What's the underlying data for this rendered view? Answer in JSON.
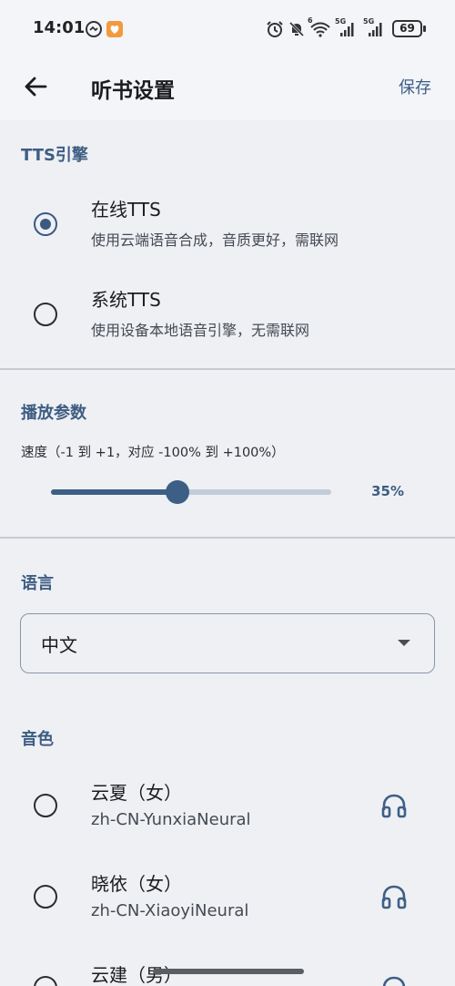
{
  "status_bar": {
    "time": "14:01",
    "battery": "69",
    "network_1": "5G",
    "network_2": "5G",
    "wifi_label": "6"
  },
  "app_bar": {
    "title": "听书设置",
    "save_label": "保存"
  },
  "tts_engine": {
    "section_title": "TTS引擎",
    "options": [
      {
        "title": "在线TTS",
        "subtitle": "使用云端语音合成，音质更好，需联网",
        "selected": true
      },
      {
        "title": "系统TTS",
        "subtitle": "使用设备本地语音引擎，无需联网",
        "selected": false
      }
    ]
  },
  "playback": {
    "section_title": "播放参数",
    "speed_hint": "速度（-1 到 +1，对应 -100% 到 +100%）",
    "speed_value": "35%",
    "speed_fraction": 0.45
  },
  "language": {
    "section_title": "语言",
    "selected": "中文"
  },
  "voice": {
    "section_title": "音色",
    "options": [
      {
        "name": "云夏（女）",
        "id": "zh-CN-YunxiaNeural"
      },
      {
        "name": "晓依（女）",
        "id": "zh-CN-XiaoyiNeural"
      },
      {
        "name": "云建（男）",
        "id": ""
      }
    ]
  },
  "colors": {
    "accent": "#3d5f86",
    "background": "#eef0f4",
    "app_bar": "#f3f5f9"
  }
}
